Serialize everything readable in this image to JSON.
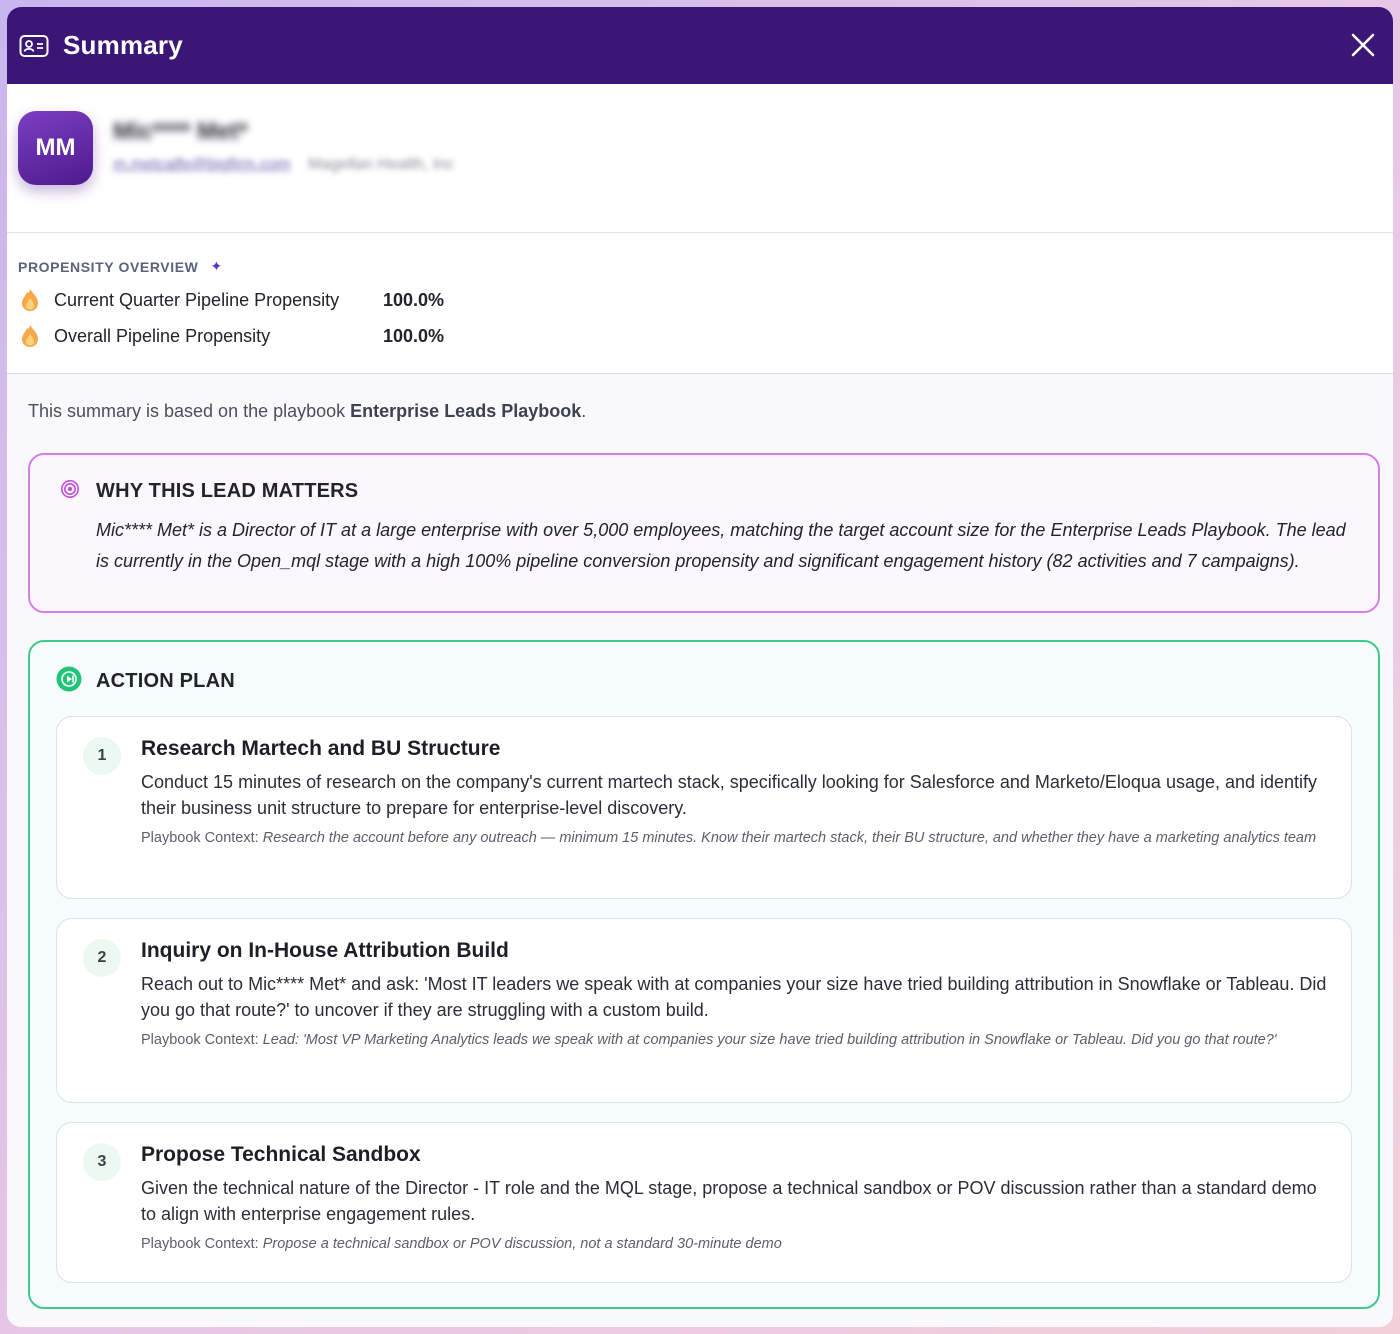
{
  "header": {
    "title": "Summary",
    "icon": "contact-card-icon",
    "close_icon": "close-icon"
  },
  "profile": {
    "initials": "MM",
    "name": "Mic**** Met*",
    "email": "m.metcalfe@bigfirm.com",
    "company": "Magellan Health, Inc"
  },
  "propensity": {
    "heading": "PROPENSITY OVERVIEW",
    "rows": [
      {
        "label": "Current Quarter Pipeline Propensity",
        "value": "100.0%"
      },
      {
        "label": "Overall Pipeline Propensity",
        "value": "100.0%"
      }
    ]
  },
  "playbook_note": {
    "prefix": "This summary is based on the playbook ",
    "playbook": "Enterprise Leads Playbook",
    "suffix": "."
  },
  "why": {
    "title": "WHY THIS LEAD MATTERS",
    "body": "Mic**** Met* is a Director of IT at a large enterprise with over 5,000 employees, matching the target account size for the Enterprise Leads Playbook. The lead is currently in the Open_mql stage with a high 100% pipeline conversion propensity and significant engagement history (82 activities and 7 campaigns)."
  },
  "action_plan": {
    "title": "ACTION PLAN",
    "context_label": "Playbook Context:",
    "steps": [
      {
        "num": "1",
        "title": "Research Martech and BU Structure",
        "desc": "Conduct 15 minutes of research on the company's current martech stack, specifically looking for Salesforce and Marketo/Eloqua usage, and identify their business unit structure to prepare for enterprise-level discovery.",
        "context": "Research the account before any outreach — minimum 15 minutes. Know their martech stack, their BU structure, and whether they have a marketing analytics team"
      },
      {
        "num": "2",
        "title": "Inquiry on In-House Attribution Build",
        "desc": "Reach out to Mic**** Met* and ask: 'Most IT leaders we speak with at companies your size have tried building attribution in Snowflake or Tableau. Did you go that route?' to uncover if they are struggling with a custom build.",
        "context": "Lead: 'Most VP Marketing Analytics leads we speak with at companies your size have tried building attribution in Snowflake or Tableau. Did you go that route?'"
      },
      {
        "num": "3",
        "title": "Propose Technical Sandbox",
        "desc": "Given the technical nature of the Director - IT role and the MQL stage, propose a technical sandbox or POV discussion rather than a standard demo to align with enterprise engagement rules.",
        "context": "Propose a technical sandbox or POV discussion, not a standard 30-minute demo"
      }
    ]
  },
  "colors": {
    "header_bg": "#3a1677",
    "why_border": "#d77ee8",
    "action_border": "#3fc98d",
    "sparkle": "#5b2fd6"
  }
}
